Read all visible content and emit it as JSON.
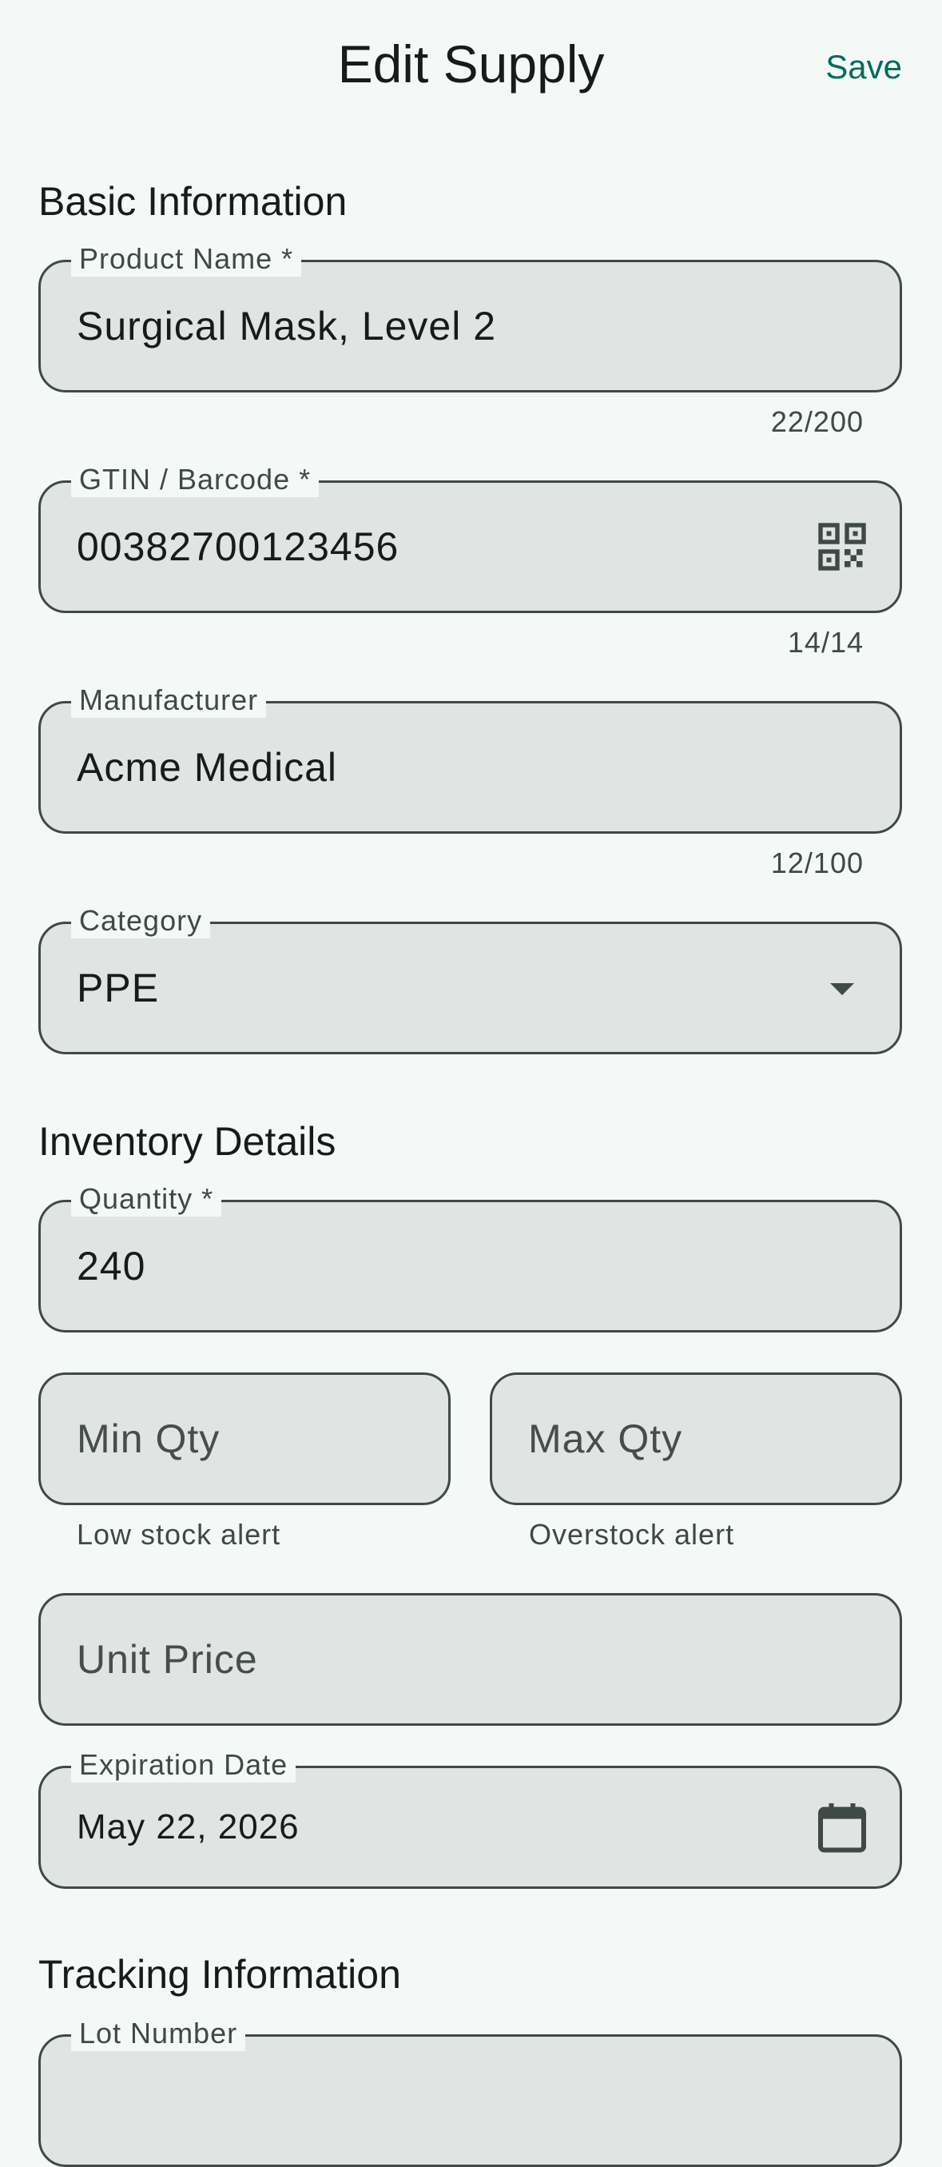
{
  "header": {
    "title": "Edit Supply",
    "save_label": "Save"
  },
  "sections": {
    "basic": "Basic Information",
    "inventory": "Inventory Details",
    "tracking": "Tracking Information"
  },
  "fields": {
    "product_name": {
      "label": "Product Name *",
      "value": "Surgical Mask, Level 2",
      "counter": "22/200"
    },
    "gtin": {
      "label": "GTIN / Barcode *",
      "value": "00382700123456",
      "counter": "14/14",
      "icon": "qr-code-scan-icon"
    },
    "manufacturer": {
      "label": "Manufacturer",
      "value": "Acme Medical",
      "counter": "12/100"
    },
    "category": {
      "label": "Category",
      "value": "PPE",
      "icon": "dropdown-arrow-icon"
    },
    "quantity": {
      "label": "Quantity *",
      "value": "240"
    },
    "min_qty": {
      "placeholder": "Min Qty",
      "helper": "Low stock alert"
    },
    "max_qty": {
      "placeholder": "Max Qty",
      "helper": "Overstock alert"
    },
    "unit_price": {
      "placeholder": "Unit Price"
    },
    "expiration": {
      "label": "Expiration Date",
      "value": "May 22, 2026",
      "icon": "calendar-icon"
    },
    "lot_number": {
      "label": "Lot Number"
    }
  },
  "colors": {
    "background": "#f4f9f7",
    "field_fill": "#e0e4e2",
    "outline": "#3f4946",
    "accent": "#006b5b",
    "text": "#171c1b"
  }
}
